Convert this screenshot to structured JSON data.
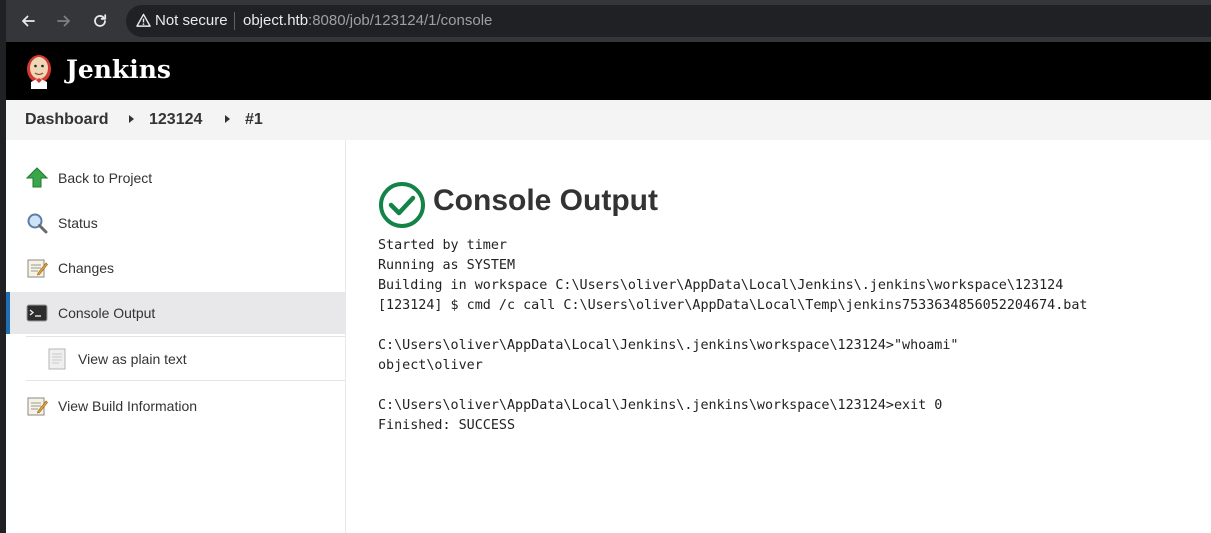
{
  "browser": {
    "security_label": "Not secure",
    "url_host": "object.htb",
    "url_rest": ":8080/job/123124/1/console"
  },
  "header": {
    "title": "Jenkins"
  },
  "breadcrumb": {
    "items": [
      "Dashboard",
      "123124",
      "#1"
    ]
  },
  "sidebar": {
    "items": [
      {
        "label": "Back to Project",
        "icon": "up-arrow-icon"
      },
      {
        "label": "Status",
        "icon": "magnifier-icon"
      },
      {
        "label": "Changes",
        "icon": "notepad-icon"
      },
      {
        "label": "Console Output",
        "icon": "terminal-icon"
      },
      {
        "label": "View as plain text",
        "icon": "document-icon"
      },
      {
        "label": "View Build Information",
        "icon": "notepad-icon"
      }
    ],
    "active_accent": "#1e6fb4"
  },
  "main": {
    "title": "Console Output",
    "status_color": "#138347",
    "console_lines": [
      "Started by timer",
      "Running as SYSTEM",
      "Building in workspace C:\\Users\\oliver\\AppData\\Local\\Jenkins\\.jenkins\\workspace\\123124",
      "[123124] $ cmd /c call C:\\Users\\oliver\\AppData\\Local\\Temp\\jenkins7533634856052204674.bat",
      "",
      "C:\\Users\\oliver\\AppData\\Local\\Jenkins\\.jenkins\\workspace\\123124>\"whoami\"",
      "object\\oliver",
      "",
      "C:\\Users\\oliver\\AppData\\Local\\Jenkins\\.jenkins\\workspace\\123124>exit 0",
      "Finished: SUCCESS"
    ]
  }
}
